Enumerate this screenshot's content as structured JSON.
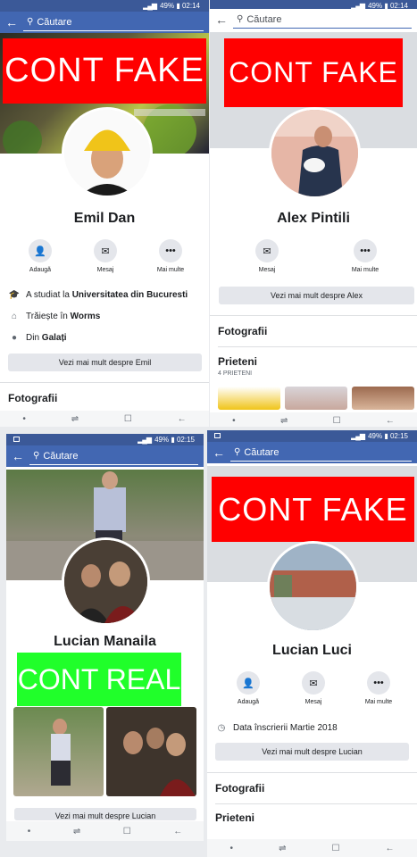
{
  "status": {
    "p1": {
      "battery": "49%",
      "time": "02:14"
    },
    "p2": {
      "battery": "49%",
      "time": "02:14"
    },
    "p3": {
      "battery": "49%",
      "time": "02:15"
    },
    "p4": {
      "battery": "49%",
      "time": "02:15"
    }
  },
  "search": {
    "placeholder": "Căutare"
  },
  "labels": {
    "fake": "CONT FAKE",
    "real": "CONT REAL"
  },
  "actions": {
    "add": "Adaugă",
    "message": "Mesaj",
    "more": "Mai multe"
  },
  "icons": {
    "back": "arrow-left-icon",
    "search": "search-icon",
    "add": "add-friend-icon",
    "message": "messenger-icon",
    "more": "more-icon"
  },
  "colors": {
    "fb_blue": "#4267b2",
    "fake_red": "#ff0000",
    "real_green": "#20ff2a"
  },
  "p1": {
    "name": "Emil Dan",
    "studied_prefix": "A studiat la ",
    "studied_place": "Universitatea din Bucuresti",
    "lives_prefix": "Trăiește în ",
    "lives_place": "Worms",
    "from_prefix": "Din ",
    "from_place": "Galați",
    "more_button": "Vezi mai mult despre Emil",
    "photos": "Fotografii"
  },
  "p2": {
    "name": "Alex Pintili",
    "more_button": "Vezi mai mult despre Alex",
    "photos": "Fotografii",
    "friends": "Prieteni",
    "friends_count": "4 PRIETENI"
  },
  "p3": {
    "name": "Lucian Manaila",
    "more_button": "Vezi mai mult despre Lucian"
  },
  "p4": {
    "name": "Lucian Luci",
    "joined": "Data înscrierii Martie 2018",
    "more_button": "Vezi mai mult despre Lucian",
    "photos": "Fotografii",
    "friends": "Prieteni"
  }
}
